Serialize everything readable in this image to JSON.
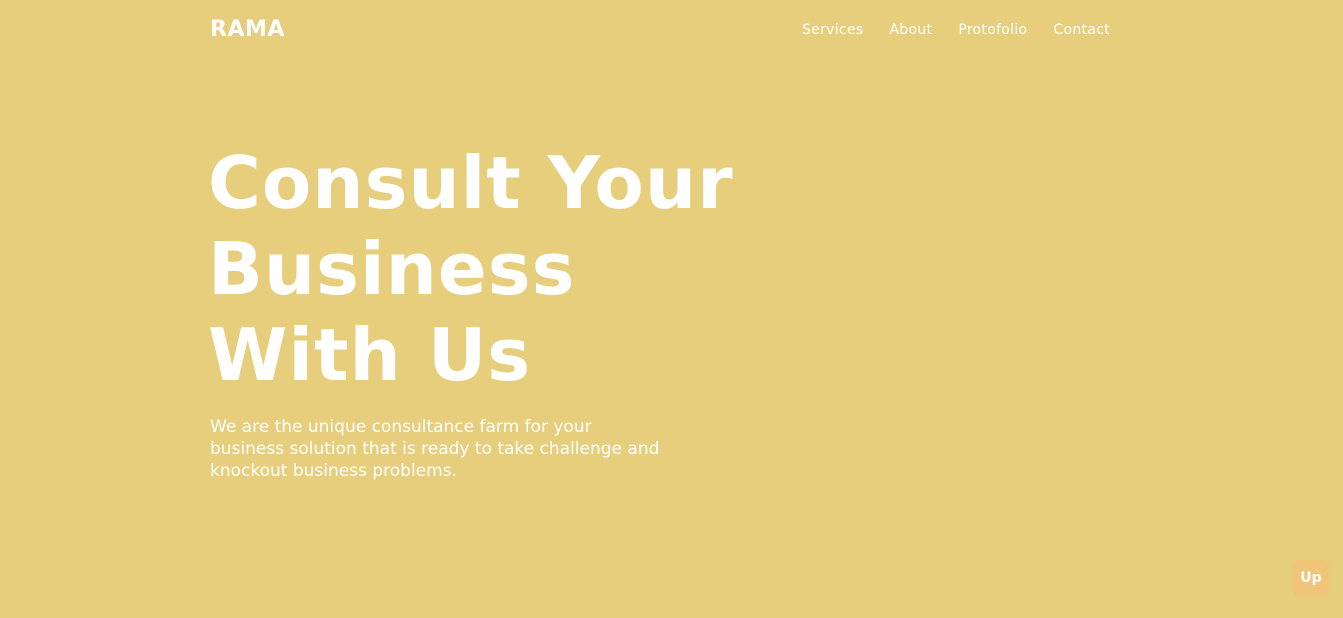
{
  "header": {
    "logo": "RAMA",
    "nav": [
      {
        "label": "Services"
      },
      {
        "label": "About"
      },
      {
        "label": "Protofolio"
      },
      {
        "label": "Contact"
      }
    ]
  },
  "hero": {
    "title_lines": [
      "Consult Your",
      "Business",
      "With Us"
    ],
    "subtitle": "We are the unique consultance farm for your business solution that is ready to take challenge and knockout business problems."
  },
  "scroll_top": {
    "label": "Up"
  },
  "colors": {
    "background": "#E6CE7C",
    "text": "#FFFFFF",
    "up_button": "#F0C57A"
  }
}
